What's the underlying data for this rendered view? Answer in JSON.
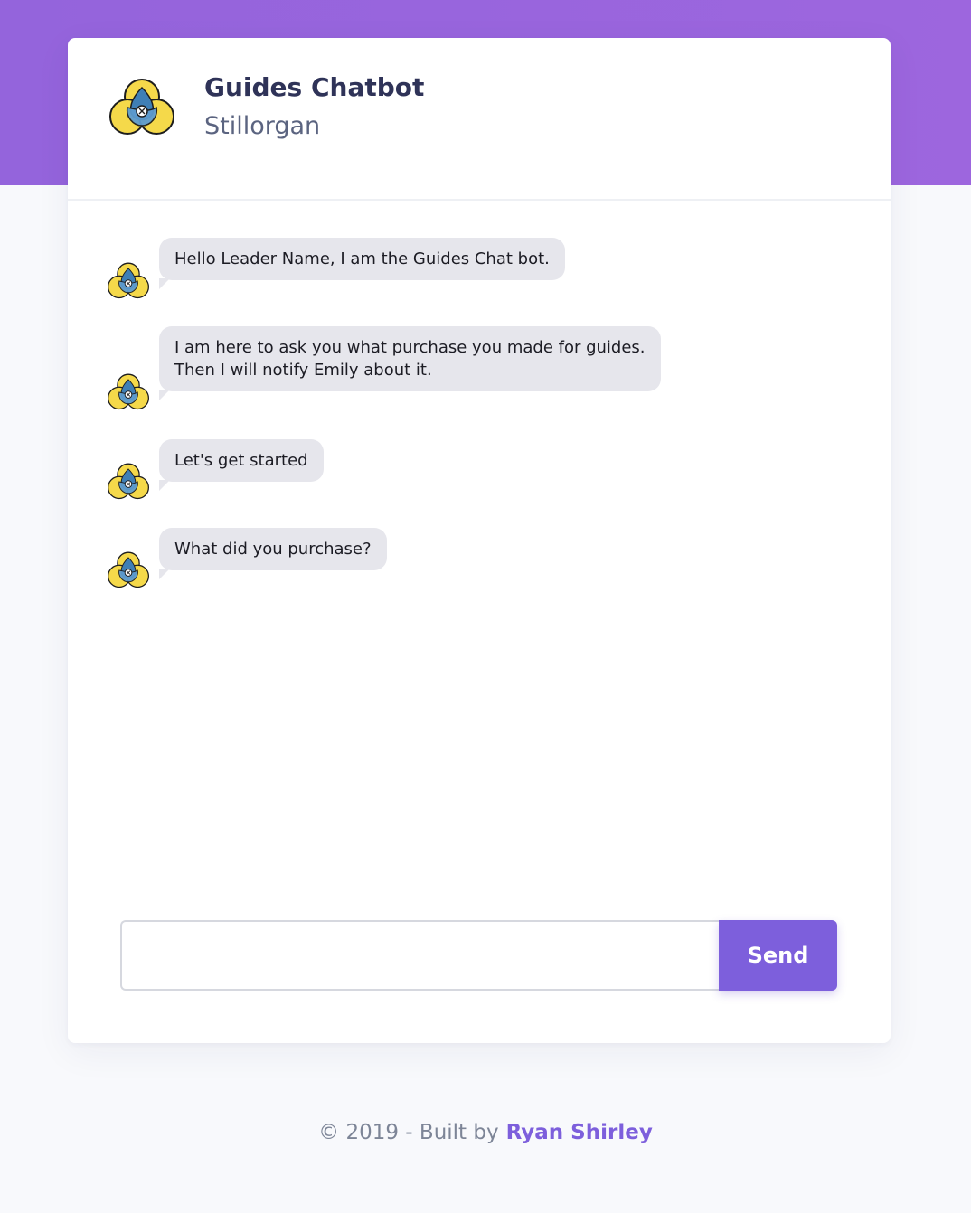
{
  "header": {
    "title": "Guides Chatbot",
    "subtitle": "Stillorgan",
    "logo_icon": "guides-trefoil-logo-icon"
  },
  "messages": [
    {
      "sender": "bot",
      "lines": [
        "Hello Leader Name, I am the Guides Chat bot."
      ]
    },
    {
      "sender": "bot",
      "lines": [
        "I am here to ask you what purchase you made for guides.",
        "Then I will notify Emily about it."
      ]
    },
    {
      "sender": "bot",
      "lines": [
        "Let's get started"
      ]
    },
    {
      "sender": "bot",
      "lines": [
        "What did you purchase?"
      ]
    }
  ],
  "composer": {
    "input_value": "",
    "input_placeholder": "",
    "send_label": "Send"
  },
  "footer": {
    "prefix": "© 2019 - Built by",
    "author_link": "Ryan Shirley"
  },
  "colors": {
    "accent": "#7d5fdc",
    "band": "#9b66de",
    "bubble": "#e6e6ec",
    "logo_yellow": "#f5d94a",
    "logo_blue": "#3f7fb6"
  }
}
